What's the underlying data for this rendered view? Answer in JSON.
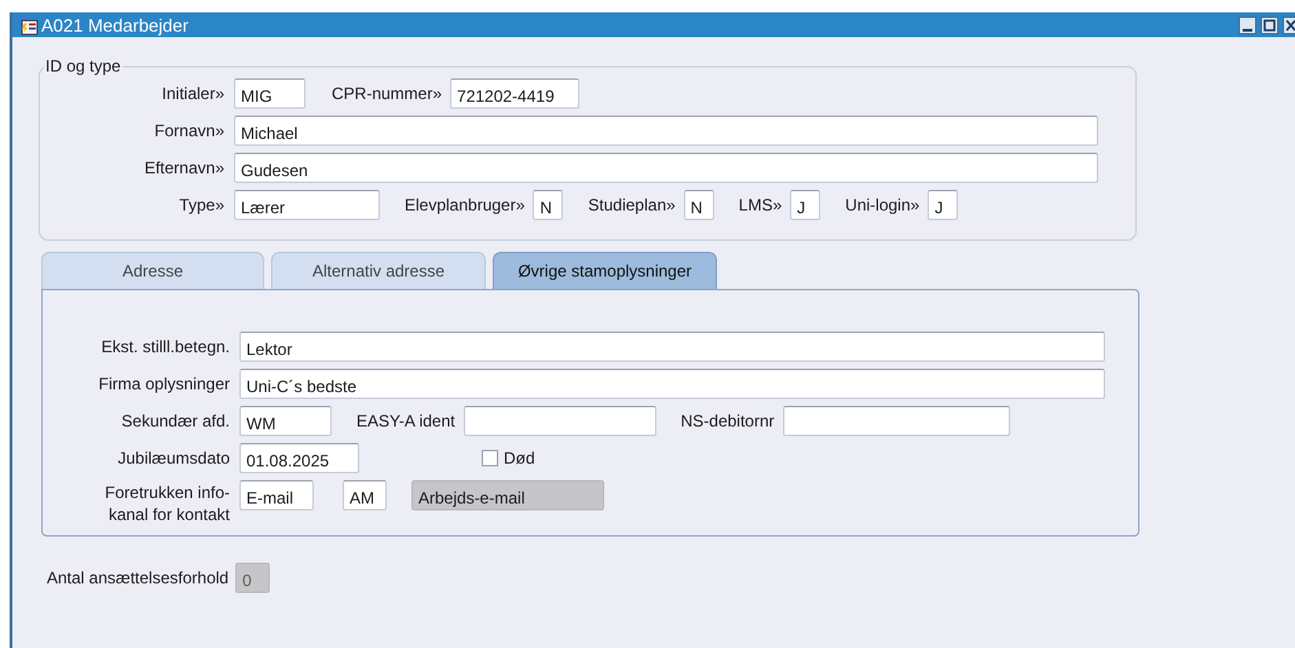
{
  "window": {
    "title": "A021 Medarbejder"
  },
  "id_group": {
    "legend": "ID og type",
    "initials": {
      "label": "Initialer»",
      "value": "MIG"
    },
    "cpr": {
      "label": "CPR-nummer»",
      "value": "721202-4419"
    },
    "first_name": {
      "label": "Fornavn»",
      "value": "Michael"
    },
    "last_name": {
      "label": "Efternavn»",
      "value": "Gudesen"
    },
    "type": {
      "label": "Type»",
      "value": "Lærer"
    },
    "flags": [
      {
        "label": "Elevplanbruger»",
        "value": "N"
      },
      {
        "label": "Studieplan»",
        "value": "N"
      },
      {
        "label": "LMS»",
        "value": "J"
      },
      {
        "label": "Uni-login»",
        "value": "J"
      }
    ]
  },
  "tabs": [
    {
      "label": "Adresse",
      "selected": false
    },
    {
      "label": "Alternativ adresse",
      "selected": false
    },
    {
      "label": "Øvrige stamoplysninger",
      "selected": true
    }
  ],
  "panel": {
    "title_ext": {
      "label": "Ekst. stilll.betegn.",
      "value": "Lektor"
    },
    "company": {
      "label": "Firma oplysninger",
      "value": "Uni-C´s bedste"
    },
    "secondary_dept": {
      "label": "Sekundær afd.",
      "value": "WM"
    },
    "easy_a": {
      "label": "EASY-A ident"
    },
    "ns_debtor": {
      "label": "NS-debitornr"
    },
    "anniversary": {
      "label": "Jubilæumsdato",
      "value": "01.08.2025"
    },
    "dead": {
      "label": "Død",
      "checked": false
    },
    "contact": {
      "label_lines": [
        "Foretrukken info-",
        "kanal for kontakt"
      ],
      "channel": "E-mail",
      "code": "AM",
      "description": {
        "value": "Arbejds-e-mail",
        "disabled": true
      }
    }
  },
  "employment_count": {
    "label": "Antal ansættelsesforhold",
    "value": "0",
    "disabled": true
  }
}
